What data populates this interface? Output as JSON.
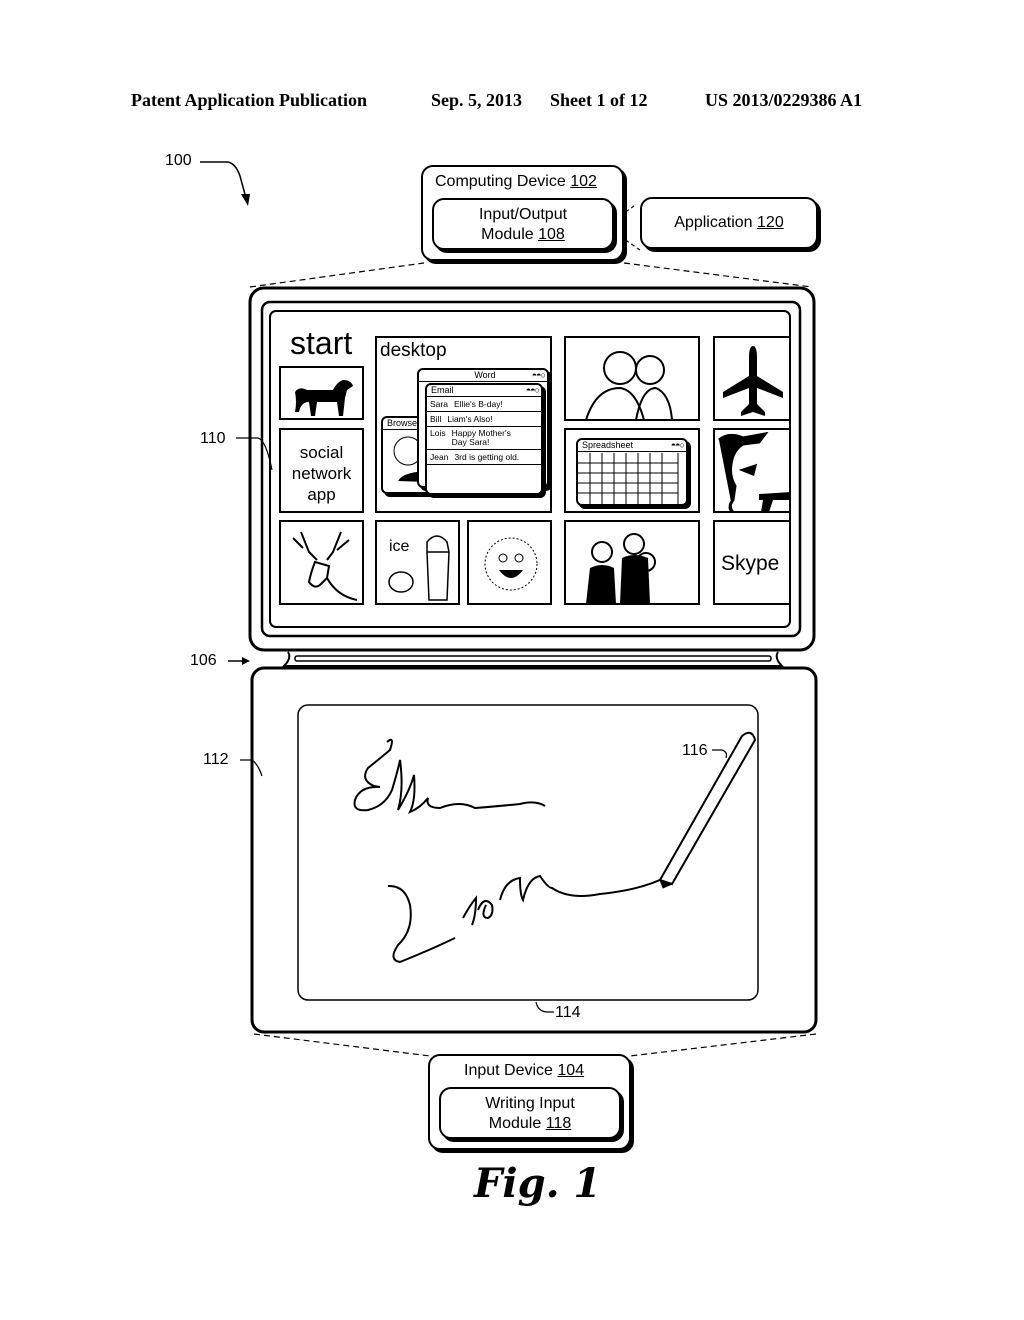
{
  "header": {
    "publication": "Patent Application Publication",
    "date": "Sep. 5, 2013",
    "sheet": "Sheet 1 of 12",
    "number": "US 2013/0229386 A1"
  },
  "refs": {
    "system": "100",
    "display": "110",
    "hinge": "106",
    "input_surface": "112",
    "writing_area": "114",
    "stylus": "116"
  },
  "computing_device": {
    "label": "Computing Device",
    "ref": "102"
  },
  "io_module": {
    "line1": "Input/Output",
    "line2": "Module",
    "ref": "108"
  },
  "application": {
    "label": "Application",
    "ref": "120"
  },
  "input_device": {
    "label": "Input Device",
    "ref": "104"
  },
  "writing_module": {
    "line1": "Writing Input",
    "line2": "Module",
    "ref": "118"
  },
  "screen": {
    "start_label": "start",
    "desktop_label": "desktop",
    "social_tile": [
      "social",
      "network",
      "app"
    ],
    "ice_label": "ice",
    "skype_label": "Skype",
    "tiles": [
      {
        "icon": "dog-icon"
      },
      {
        "icon": "father-son-photo-icon"
      },
      {
        "icon": "airplane-icon"
      },
      {
        "icon": "monkey-gun-icon"
      },
      {
        "icon": "deer-icon"
      },
      {
        "icon": "lemon-shaker-icon"
      },
      {
        "icon": "sun-face-icon"
      },
      {
        "icon": "group-photo-icon"
      }
    ],
    "word_window": {
      "title": "Word"
    },
    "browser_window": {
      "title": "Browser"
    },
    "spreadsheet_window": {
      "title": "Spreadsheet"
    },
    "email_window": {
      "title": "Email",
      "rows": [
        {
          "from": "Sara",
          "subject": "Ellie's B-day!"
        },
        {
          "from": "Bill",
          "subject": "Liam's Also!"
        },
        {
          "from": "Lois",
          "subject": "Happy Mother's Day Sara!"
        },
        {
          "from": "Jean",
          "subject": "3rd is getting old."
        }
      ]
    }
  },
  "handwriting": [
    "Ellie",
    "Liam"
  ],
  "figure_caption": "Fig. 1"
}
